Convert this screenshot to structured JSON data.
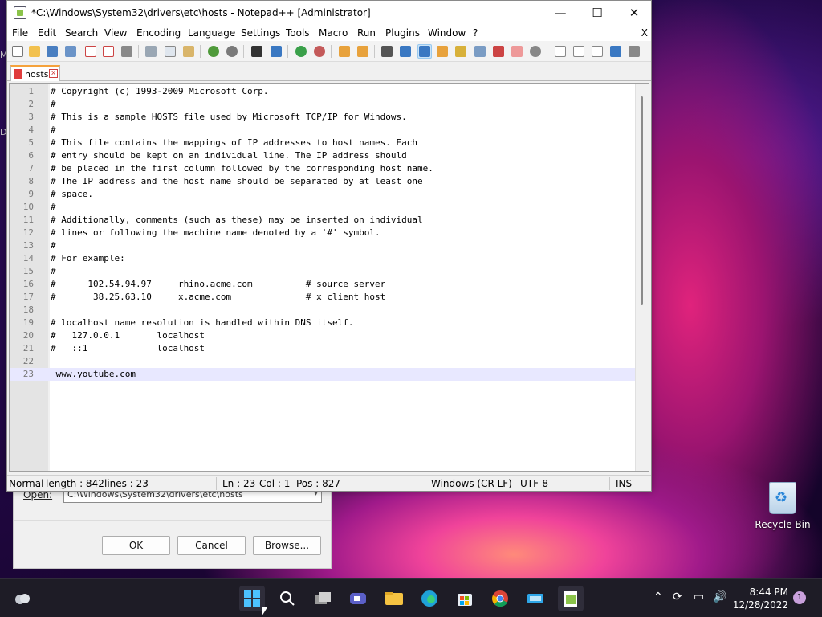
{
  "window": {
    "title": "*C:\\Windows\\System32\\drivers\\etc\\hosts - Notepad++ [Administrator]",
    "controls": {
      "minimize": "—",
      "maximize": "☐",
      "close": "✕"
    }
  },
  "menu": {
    "items": [
      "File",
      "Edit",
      "Search",
      "View",
      "Encoding",
      "Language",
      "Settings",
      "Tools",
      "Macro",
      "Run",
      "Plugins",
      "Window",
      "?"
    ],
    "close": "X"
  },
  "tab": {
    "label": "hosts",
    "close": "x"
  },
  "editor": {
    "lines": [
      {
        "n": "1",
        "text": "# Copyright (c) 1993-2009 Microsoft Corp."
      },
      {
        "n": "2",
        "text": "#"
      },
      {
        "n": "3",
        "text": "# This is a sample HOSTS file used by Microsoft TCP/IP for Windows."
      },
      {
        "n": "4",
        "text": "#"
      },
      {
        "n": "5",
        "text": "# This file contains the mappings of IP addresses to host names. Each"
      },
      {
        "n": "6",
        "text": "# entry should be kept on an individual line. The IP address should"
      },
      {
        "n": "7",
        "text": "# be placed in the first column followed by the corresponding host name."
      },
      {
        "n": "8",
        "text": "# The IP address and the host name should be separated by at least one"
      },
      {
        "n": "9",
        "text": "# space."
      },
      {
        "n": "10",
        "text": "#"
      },
      {
        "n": "11",
        "text": "# Additionally, comments (such as these) may be inserted on individual"
      },
      {
        "n": "12",
        "text": "# lines or following the machine name denoted by a '#' symbol."
      },
      {
        "n": "13",
        "text": "#"
      },
      {
        "n": "14",
        "text": "# For example:"
      },
      {
        "n": "15",
        "text": "#"
      },
      {
        "n": "16",
        "text": "#      102.54.94.97     rhino.acme.com          # source server"
      },
      {
        "n": "17",
        "text": "#       38.25.63.10     x.acme.com              # x client host"
      },
      {
        "n": "18",
        "text": ""
      },
      {
        "n": "19",
        "text": "# localhost name resolution is handled within DNS itself."
      },
      {
        "n": "20",
        "text": "#   127.0.0.1       localhost"
      },
      {
        "n": "21",
        "text": "#   ::1             localhost"
      },
      {
        "n": "22",
        "text": ""
      },
      {
        "n": "23",
        "text": " www.youtube.com"
      }
    ]
  },
  "status": {
    "mode": "Normal",
    "length": "length : 842",
    "lines": "lines : 23",
    "ln": "Ln : 23",
    "col": "Col : 1",
    "pos": "Pos : 827",
    "eol": "Windows (CR LF)",
    "encoding": "UTF-8",
    "ins": "INS"
  },
  "run_dialog": {
    "open_label": "Open:",
    "open_value": "C:\\Windows\\System32\\drivers\\etc\\hosts",
    "ok": "OK",
    "cancel": "Cancel",
    "browse": "Browse..."
  },
  "desktop": {
    "recycle_bin": "Recycle Bin",
    "side_m": "M",
    "side_d": "D"
  },
  "taskbar": {
    "time": "8:44 PM",
    "date": "12/28/2022",
    "notifications": "1",
    "icons": [
      "weather-icon",
      "windows-start-icon",
      "search-icon",
      "task-view-icon",
      "teams-chat-icon",
      "file-explorer-icon",
      "edge-icon",
      "store-icon",
      "chrome-icon",
      "app-icon",
      "notepadpp-icon"
    ]
  },
  "colors": {
    "accent_tab": "#f5a23c",
    "current_line": "#e8e8ff",
    "taskbar": "#1e1c26"
  }
}
